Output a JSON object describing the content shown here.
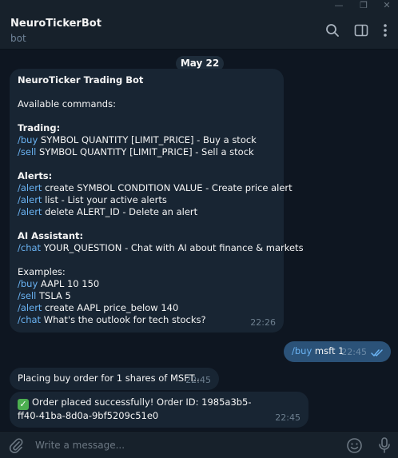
{
  "window": {
    "minimize": "—",
    "maximize": "❐",
    "close": "✕"
  },
  "header": {
    "name": "NeuroTickerBot",
    "status": "bot"
  },
  "date_chip": "May 22",
  "messages": {
    "help": {
      "lines": [
        {
          "text": "NeuroTicker Trading Bot",
          "style": "title"
        },
        {
          "text": "",
          "style": "blank"
        },
        {
          "text": "Available commands:",
          "style": "normal"
        },
        {
          "text": "",
          "style": "blank"
        },
        {
          "text": "Trading:",
          "style": "sec"
        },
        {
          "cmd": "/buy",
          "text": " SYMBOL QUANTITY [LIMIT_PRICE] - Buy a stock",
          "style": "cmd"
        },
        {
          "cmd": "/sell",
          "text": " SYMBOL QUANTITY [LIMIT_PRICE] - Sell a stock",
          "style": "cmd"
        },
        {
          "text": "",
          "style": "blank"
        },
        {
          "text": "Alerts:",
          "style": "sec"
        },
        {
          "cmd": "/alert",
          "text": " create SYMBOL CONDITION VALUE - Create price alert",
          "style": "cmd"
        },
        {
          "cmd": "/alert",
          "text": " list - List your active alerts",
          "style": "cmd"
        },
        {
          "cmd": "/alert",
          "text": " delete ALERT_ID - Delete an alert",
          "style": "cmd"
        },
        {
          "text": "",
          "style": "blank"
        },
        {
          "text": "AI Assistant:",
          "style": "sec"
        },
        {
          "cmd": "/chat",
          "text": " YOUR_QUESTION - Chat with AI about finance & markets",
          "style": "cmd"
        },
        {
          "text": "",
          "style": "blank"
        },
        {
          "text": "Examples:",
          "style": "normal"
        },
        {
          "cmd": "/buy",
          "text": " AAPL 10 150",
          "style": "cmd"
        },
        {
          "cmd": "/sell",
          "text": " TSLA 5",
          "style": "cmd"
        },
        {
          "cmd": "/alert",
          "text": " create AAPL price_below 140",
          "style": "cmd"
        },
        {
          "cmd": "/chat",
          "text": " What's the outlook for tech stocks?",
          "style": "cmd"
        }
      ],
      "time": "22:26"
    },
    "user_buy": {
      "cmd": "/buy",
      "text": " msft 1",
      "time": "22:45"
    },
    "placing": {
      "text": "Placing buy order for 1 shares of MSFT...",
      "time": "22:45"
    },
    "placed": {
      "check": "✓",
      "line1": "Order placed successfully! Order ID: 1985a3b5-",
      "line2": "ff40-41ba-8d0a-9bf5209c51e0",
      "time": "22:45"
    }
  },
  "composer": {
    "placeholder": "Write a message..."
  },
  "colors": {
    "accent": "#6ab3f3",
    "bubble_in": "#182533",
    "bubble_out": "#2b5278",
    "background": "#0e1621"
  }
}
